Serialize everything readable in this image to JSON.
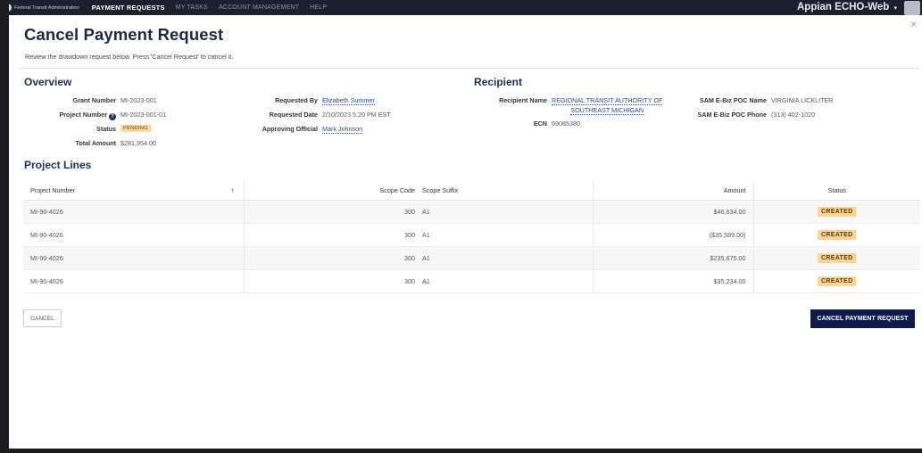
{
  "topnav": {
    "agency": "Federal Transit Administration",
    "items": [
      {
        "label": "PAYMENT REQUESTS",
        "active": true
      },
      {
        "label": "MY TASKS",
        "active": false
      },
      {
        "label": "ACCOUNT MANAGEMENT",
        "active": false
      },
      {
        "label": "HELP",
        "active": false
      }
    ],
    "user": "Appian ECHO-Web",
    "user_caret": "▾"
  },
  "dialog": {
    "title": "Cancel Payment Request",
    "subtitle": "Review the drawdown request below. Press 'Cancel Request' to cancel it.",
    "close": "×"
  },
  "overview": {
    "heading": "Overview",
    "grant_number": {
      "label": "Grant Number",
      "value": "MI-2023-001"
    },
    "project_number": {
      "label": "Project Number",
      "value": "MI-2023-001-01"
    },
    "status": {
      "label": "Status",
      "value": "PENDING"
    },
    "total_amount": {
      "label": "Total Amount",
      "value": "$281,954.00"
    },
    "requested_by": {
      "label": "Requested By",
      "value": "Elizabeth Summer"
    },
    "requested_date": {
      "label": "Requested Date",
      "value": "2/10/2023 5:20 PM EST"
    },
    "approving_official": {
      "label": "Approving Official",
      "value": "Mark Johnson"
    }
  },
  "recipient": {
    "heading": "Recipient",
    "recipient_name": {
      "label": "Recipient Name",
      "value_line1": "REGIONAL TRANSIT AUTHORITY OF",
      "value_line2": "SOUTHEAST MICHIGAN"
    },
    "ecn": {
      "label": "ECN",
      "value": "69085380"
    },
    "sam_poc_name": {
      "label": "SAM E-Biz POC Name",
      "value": "VIRGINIA LICKLITER"
    },
    "sam_poc_phone": {
      "label": "SAM E-Biz POC Phone",
      "value": "(313) 402-1020"
    }
  },
  "project_lines": {
    "heading": "Project Lines",
    "columns": {
      "project_number": "Project Number",
      "scope_code": "Scope Code",
      "scope_suffix": "Scope Suffix",
      "amount": "Amount",
      "status": "Status"
    },
    "sort_icon": "↑",
    "rows": [
      {
        "project_number": "MI-90-4026",
        "scope_code": "300",
        "scope_suffix": "A1",
        "amount": "$46,634.00",
        "status": "CREATED"
      },
      {
        "project_number": "MI-90-4026",
        "scope_code": "300",
        "scope_suffix": "A1",
        "amount": "($35,589.00)",
        "status": "CREATED"
      },
      {
        "project_number": "MI-90-4026",
        "scope_code": "300",
        "scope_suffix": "A1",
        "amount": "$235,675.00",
        "status": "CREATED"
      },
      {
        "project_number": "MI-90-4026",
        "scope_code": "300",
        "scope_suffix": "A1",
        "amount": "$35,234.00",
        "status": "CREATED"
      }
    ]
  },
  "actions": {
    "cancel_label": "CANCEL",
    "submit_label": "CANCEL PAYMENT REQUEST"
  },
  "colors": {
    "primary": "#101a4f",
    "nav_bg": "#1c1f2c",
    "badge_bg": "#fbd49a",
    "heading": "#1e2f52"
  }
}
